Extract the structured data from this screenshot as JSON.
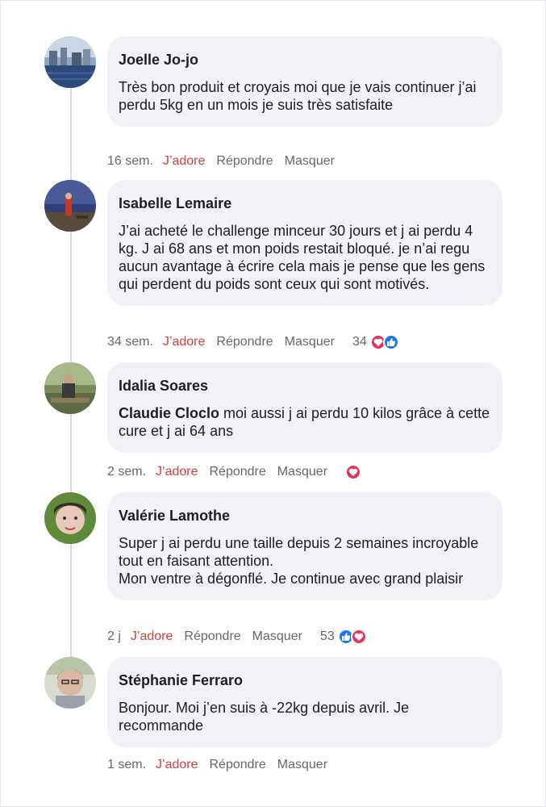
{
  "colors": {
    "bubble_bg": "#f0f2f5",
    "love_action": "#d43d3a",
    "meta_text": "#65676b",
    "heart_reaction": "#e4345b",
    "like_reaction": "#1877f2"
  },
  "comments": [
    {
      "author": "Joelle Jo-jo",
      "text": "Très bon produit et croyais moi que je vais continuer j’ai perdu 5kg en un mois je suis très satisfaite",
      "time": "16 sem.",
      "love_label": "J’adore",
      "reply_label": "Répondre",
      "hide_label": "Masquer",
      "reaction_count": "",
      "reactions": []
    },
    {
      "author": "Isabelle Lemaire",
      "text": "J’ai acheté le challenge minceur 30 jours et j ai perdu 4 kg. J ai 68 ans et mon poids restait bloqué. je n’ai regu aucun avantage à écrire cela mais je pense que les gens qui perdent du poids sont ceux qui sont motivés.",
      "time": "34 sem.",
      "love_label": "J’adore",
      "reply_label": "Répondre",
      "hide_label": "Masquer",
      "reaction_count": "34",
      "reactions": [
        "heart-icon",
        "like-icon"
      ]
    },
    {
      "author": "Idalia Soares",
      "mention": "Claudie Cloclo",
      "text": " moi aussi j ai perdu 10 kilos grâce à cette cure et j ai 64 ans",
      "time": "2 sem.",
      "love_label": "J’adore",
      "reply_label": "Répondre",
      "hide_label": "Masquer",
      "reaction_count": "",
      "reactions": [
        "heart-icon"
      ]
    },
    {
      "author": "Valérie Lamothe",
      "text": "Super j ai perdu une taille depuis 2 semaines incroyable tout en faisant attention.\n Mon ventre à dégonflé. Je continue avec grand plaisir",
      "time": "2 j",
      "love_label": "J’adore",
      "reply_label": "Répondre",
      "hide_label": "Masquer",
      "reaction_count": "53",
      "reactions": [
        "like-icon",
        "heart-icon"
      ]
    },
    {
      "author": "Stéphanie Ferraro",
      "text": "Bonjour. Moi j’en suis à -22kg depuis avril. Je recommande",
      "time": "1 sem.",
      "love_label": "J’adore",
      "reply_label": "Répondre",
      "hide_label": "Masquer",
      "reaction_count": "",
      "reactions": []
    }
  ]
}
